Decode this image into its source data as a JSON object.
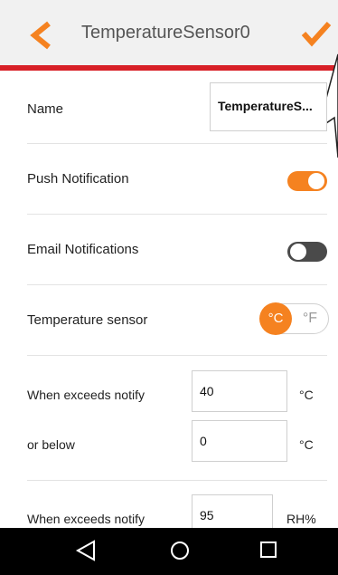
{
  "header": {
    "title": "TemperatureSensor0",
    "back_icon": "chevron-left-icon",
    "confirm_icon": "checkmark-icon",
    "accent": "#f58220",
    "brand_bar": "#d82027"
  },
  "settings": {
    "name": {
      "label": "Name",
      "value": "TemperatureS..."
    },
    "push": {
      "label": "Push Notification",
      "state": "on"
    },
    "email": {
      "label": "Email Notifications",
      "state": "off"
    },
    "sensor_unit": {
      "label": "Temperature sensor",
      "celsius": "°C",
      "fahrenheit": "°F",
      "selected": "°C"
    }
  },
  "temperature_thresholds": {
    "exceeds_label": "When exceeds notify",
    "exceeds_value": "40",
    "exceeds_unit": "°C",
    "below_label": "or below",
    "below_value": "0",
    "below_unit": "°C"
  },
  "humidity_thresholds": {
    "exceeds_label": "When exceeds notify",
    "exceeds_value": "95",
    "exceeds_unit": "RH%"
  },
  "system_nav": {
    "back_icon": "nav-back-icon",
    "home_icon": "nav-home-icon",
    "recent_icon": "nav-recent-icon"
  }
}
